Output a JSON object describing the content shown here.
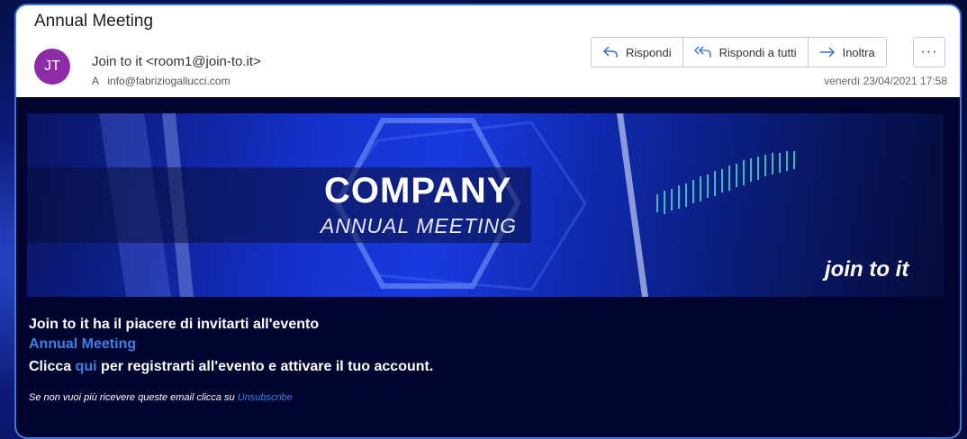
{
  "email": {
    "subject": "Annual Meeting",
    "avatar_initials": "JT",
    "avatar_color": "#8e2ba6",
    "sender": "Join to it <room1@join-to.it>",
    "recipient_prefix": "A",
    "recipient": "info@fabriziogallucci.com",
    "date": "venerdì 23/04/2021 17:58",
    "actions": {
      "reply": "Rispondi",
      "reply_all": "Rispondi a tutti",
      "forward": "Inoltra",
      "more": "···"
    }
  },
  "banner": {
    "title": "COMPANY",
    "subtitle": "ANNUAL MEETING",
    "logo": "join to it"
  },
  "message": {
    "line1": "Join to it ha il piacere di invitarti all'evento",
    "event_name": "Annual Meeting",
    "line3_before": "Clicca",
    "line3_link": "qui",
    "line3_after": "per registrarti all'evento e attivare il tuo account.",
    "footer_text": "Se non vuoi più ricevere queste email clicca su",
    "footer_link": "Unsubscribe"
  },
  "colors": {
    "accent": "#3a78d8",
    "link": "#3d82e0",
    "body_bg": "#020430"
  }
}
